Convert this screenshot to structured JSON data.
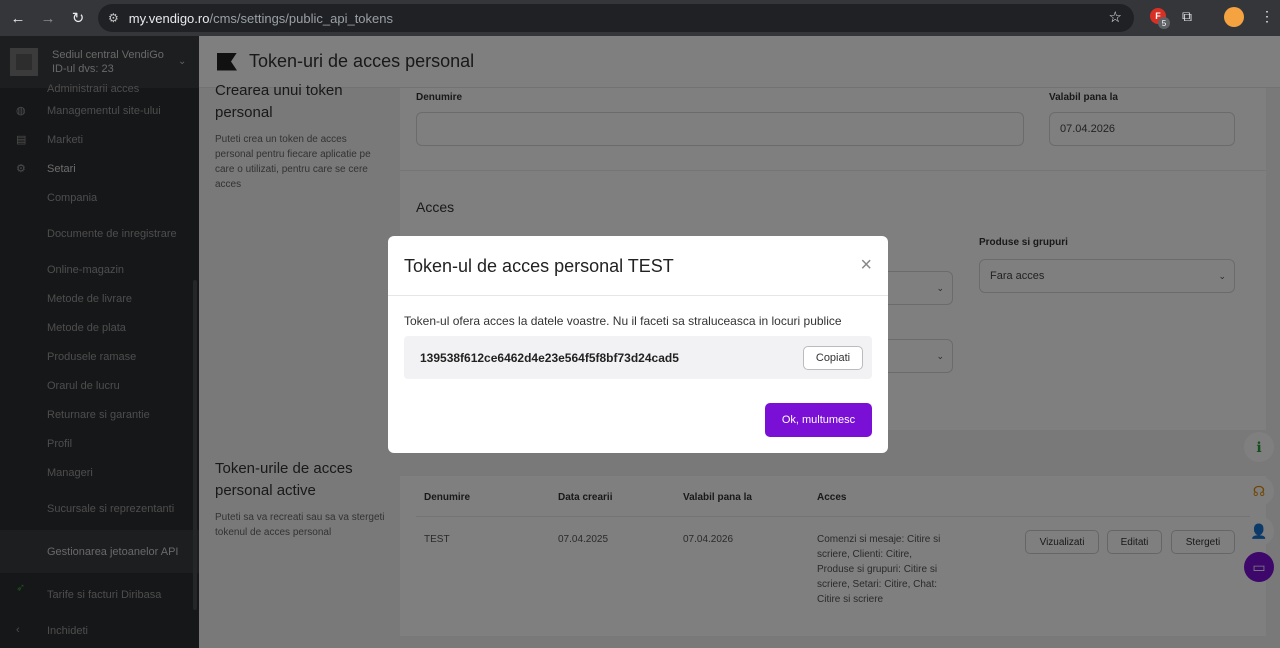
{
  "browser": {
    "url_host": "my.vendigo.ro",
    "url_path": "/cms/settings/public_api_tokens",
    "ext_badge": "5",
    "ext_label": "F"
  },
  "sidebar": {
    "store_name": "Sediul central VendiGo",
    "store_id": "ID-ul dvs: 23",
    "items": [
      {
        "label": "Administrarii acces"
      },
      {
        "label": "Managementul site-ului"
      },
      {
        "label": "Marketi"
      },
      {
        "label": "Setari"
      },
      {
        "label": "Compania"
      },
      {
        "label": "Documente de inregistrare"
      },
      {
        "label": "Online-magazin"
      },
      {
        "label": "Metode de livrare"
      },
      {
        "label": "Metode de plata"
      },
      {
        "label": "Produsele ramase"
      },
      {
        "label": "Orarul de lucru"
      },
      {
        "label": "Returnare si garantie"
      },
      {
        "label": "Profil"
      },
      {
        "label": "Manageri"
      },
      {
        "label": "Sucursale si reprezentanti"
      },
      {
        "label": "Gestionarea jetoanelor API"
      },
      {
        "label": "Tarife si facturi Diribasa"
      },
      {
        "label": "Inchideti"
      }
    ]
  },
  "page": {
    "title": "Token-uri de acces personal",
    "create_title": "Crearea unui token personal",
    "create_desc": "Puteti crea un token de acces personal pentru fiecare aplicatie pe care o utilizati, pentru care se cere acces",
    "name_label": "Denumire",
    "valid_label": "Valabil pana la",
    "valid_value": "07.04.2026",
    "access_title": "Acces",
    "products_label": "Produse si grupuri",
    "products_value": "Fara acces",
    "active_title": "Token-urile de acces personal active",
    "active_desc": "Puteti sa va recreati sau sa va stergeti tokenul de acces personal",
    "table": {
      "headers": [
        "Denumire",
        "Data crearii",
        "Valabil pana la",
        "Acces"
      ],
      "row": {
        "name": "TEST",
        "created": "07.04.2025",
        "valid": "07.04.2026",
        "access": "Comenzi si mesaje: Citire si scriere, Clienti: Citire, Produse si grupuri: Citire si scriere, Setari: Citire, Chat: Citire si scriere"
      },
      "buttons": {
        "view": "Vizualizati",
        "edit": "Editati",
        "delete": "Stergeti"
      }
    }
  },
  "modal": {
    "title": "Token-ul de acces personal TEST",
    "close": "×",
    "text": "Token-ul ofera acces la datele voastre. Nu il faceti sa straluceasca in locuri publice",
    "token": "139538f612ce6462d4e23e564f5f8bf73d24cad5",
    "copy_label": "Copiati",
    "ok_label": "Ok, multumesc"
  },
  "colors": {
    "primary": "#7a0fd6",
    "overlay": "rgba(0,0,0,0.5)"
  }
}
